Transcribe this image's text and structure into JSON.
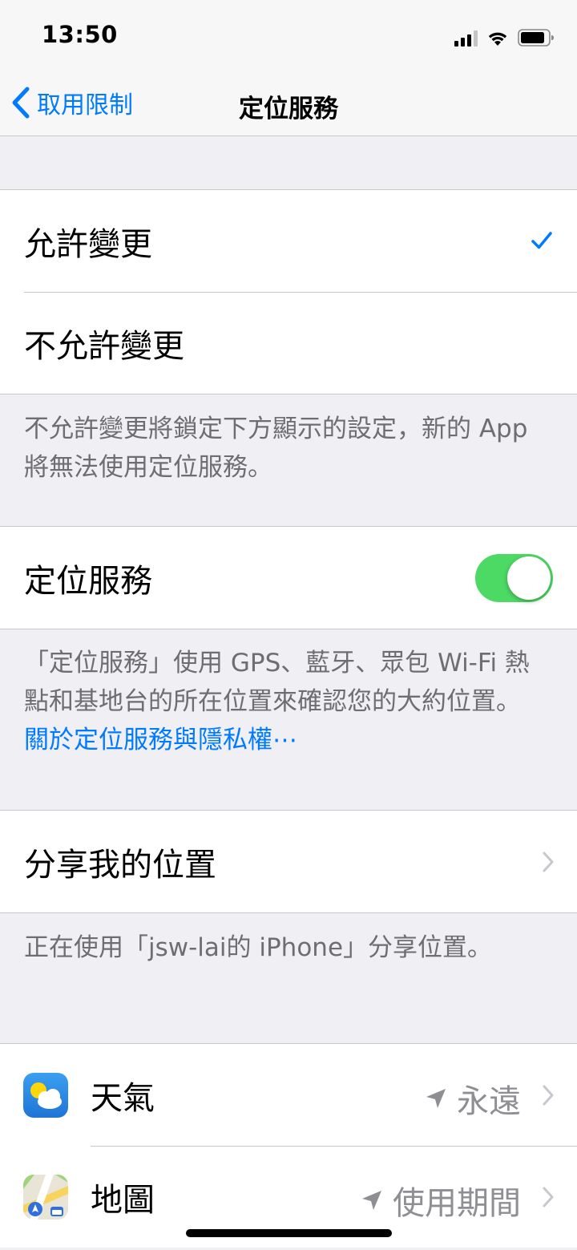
{
  "status_bar": {
    "time": "13:50"
  },
  "nav": {
    "back_label": "取用限制",
    "title": "定位服務"
  },
  "change_options": {
    "items": [
      {
        "label": "允許變更",
        "selected": true
      },
      {
        "label": "不允許變更",
        "selected": false
      }
    ],
    "footer": "不允許變更將鎖定下方顯示的設定，新的 App 將無法使用定位服務。"
  },
  "location_services": {
    "label": "定位服務",
    "enabled": true,
    "footer_text": "「定位服務」使用 GPS、藍牙、眾包 Wi-Fi 熱點和基地台的所在位置來確認您的大約位置。",
    "footer_link": "關於定位服務與隱私權⋯"
  },
  "share_location": {
    "label": "分享我的位置",
    "footer": "正在使用「jsw-lai的 iPhone」分享位置。"
  },
  "apps": [
    {
      "name": "天氣",
      "value": "永遠",
      "icon": "weather-app-icon"
    },
    {
      "name": "地圖",
      "value": "使用期間",
      "icon": "maps-app-icon"
    }
  ],
  "colors": {
    "accent": "#007aff",
    "toggle_on": "#4cd964",
    "background": "#efeff4",
    "secondary_text": "#6d6d72"
  }
}
